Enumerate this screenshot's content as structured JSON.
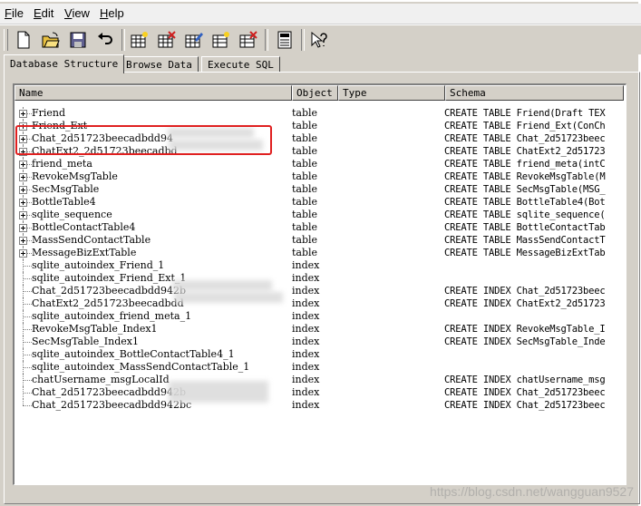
{
  "menu": [
    {
      "hot": "F",
      "rest": "ile"
    },
    {
      "hot": "E",
      "rest": "dit"
    },
    {
      "hot": "V",
      "rest": "iew"
    },
    {
      "hot": "H",
      "rest": "elp"
    }
  ],
  "toolbar_icons": [
    "new-file-icon",
    "open-folder-icon",
    "save-icon",
    "undo-icon",
    "create-table-icon",
    "delete-table-icon",
    "modify-table-icon",
    "create-index-icon",
    "delete-index-icon",
    "log-icon",
    "whats-this-icon"
  ],
  "tabs": [
    "Database Structure",
    "Browse Data",
    "Execute SQL"
  ],
  "columns": [
    "Name",
    "Object",
    "Type",
    "Schema"
  ],
  "rows": [
    {
      "kind": "table",
      "name": "Friend",
      "object": "table",
      "type": "",
      "schema": "CREATE TABLE Friend(Draft TEX"
    },
    {
      "kind": "table",
      "name": "Friend_Ext",
      "object": "table",
      "type": "",
      "schema": "CREATE TABLE Friend_Ext(ConCh"
    },
    {
      "kind": "table",
      "name": "Chat_2d51723beecadbdd94",
      "object": "table",
      "type": "",
      "schema": "CREATE TABLE Chat_2d51723beec"
    },
    {
      "kind": "table",
      "name": "ChatExt2_2d51723beecadbd",
      "object": "table",
      "type": "",
      "schema": "CREATE TABLE ChatExt2_2d51723"
    },
    {
      "kind": "table",
      "name": "friend_meta",
      "object": "table",
      "type": "",
      "schema": "CREATE TABLE friend_meta(intC"
    },
    {
      "kind": "table",
      "name": "RevokeMsgTable",
      "object": "table",
      "type": "",
      "schema": "CREATE TABLE RevokeMsgTable(M"
    },
    {
      "kind": "table",
      "name": "SecMsgTable",
      "object": "table",
      "type": "",
      "schema": "CREATE TABLE SecMsgTable(MSG_"
    },
    {
      "kind": "table",
      "name": "BottleTable4",
      "object": "table",
      "type": "",
      "schema": "CREATE TABLE BottleTable4(Bot"
    },
    {
      "kind": "table",
      "name": "sqlite_sequence",
      "object": "table",
      "type": "",
      "schema": "CREATE TABLE sqlite_sequence("
    },
    {
      "kind": "table",
      "name": "BottleContactTable4",
      "object": "table",
      "type": "",
      "schema": "CREATE TABLE BottleContactTab"
    },
    {
      "kind": "table",
      "name": "MassSendContactTable",
      "object": "table",
      "type": "",
      "schema": "CREATE TABLE MassSendContactT"
    },
    {
      "kind": "table",
      "name": "MessageBizExtTable",
      "object": "table",
      "type": "",
      "schema": "CREATE TABLE MessageBizExtTab"
    },
    {
      "kind": "index",
      "name": "sqlite_autoindex_Friend_1",
      "object": "index",
      "type": "",
      "schema": ""
    },
    {
      "kind": "index",
      "name": "sqlite_autoindex_Friend_Ext_1",
      "object": "index",
      "type": "",
      "schema": ""
    },
    {
      "kind": "index",
      "name": "Chat_2d51723beecadbdd942b",
      "object": "index",
      "type": "",
      "schema": "CREATE INDEX Chat_2d51723beec"
    },
    {
      "kind": "index",
      "name": "ChatExt2_2d51723beecadbdd",
      "object": "index",
      "type": "",
      "schema": "CREATE INDEX ChatExt2_2d51723"
    },
    {
      "kind": "index",
      "name": "sqlite_autoindex_friend_meta_1",
      "object": "index",
      "type": "",
      "schema": ""
    },
    {
      "kind": "index",
      "name": "RevokeMsgTable_Index1",
      "object": "index",
      "type": "",
      "schema": "CREATE INDEX RevokeMsgTable_I"
    },
    {
      "kind": "index",
      "name": "SecMsgTable_Index1",
      "object": "index",
      "type": "",
      "schema": "CREATE INDEX SecMsgTable_Inde"
    },
    {
      "kind": "index",
      "name": "sqlite_autoindex_BottleContactTable4_1",
      "object": "index",
      "type": "",
      "schema": ""
    },
    {
      "kind": "index",
      "name": "sqlite_autoindex_MassSendContactTable_1",
      "object": "index",
      "type": "",
      "schema": ""
    },
    {
      "kind": "index",
      "name": "chatUsername_msgLocalId",
      "object": "index",
      "type": "",
      "schema": "CREATE INDEX chatUsername_msg"
    },
    {
      "kind": "index",
      "name": "Chat_2d51723beecadbdd942b",
      "object": "index",
      "type": "",
      "schema": "CREATE INDEX Chat_2d51723beec"
    },
    {
      "kind": "index",
      "name": "Chat_2d51723beecadbdd942bc",
      "object": "index",
      "type": "",
      "schema": "CREATE INDEX Chat_2d51723beec"
    }
  ],
  "watermark": "https://blog.csdn.net/wangguan9527"
}
